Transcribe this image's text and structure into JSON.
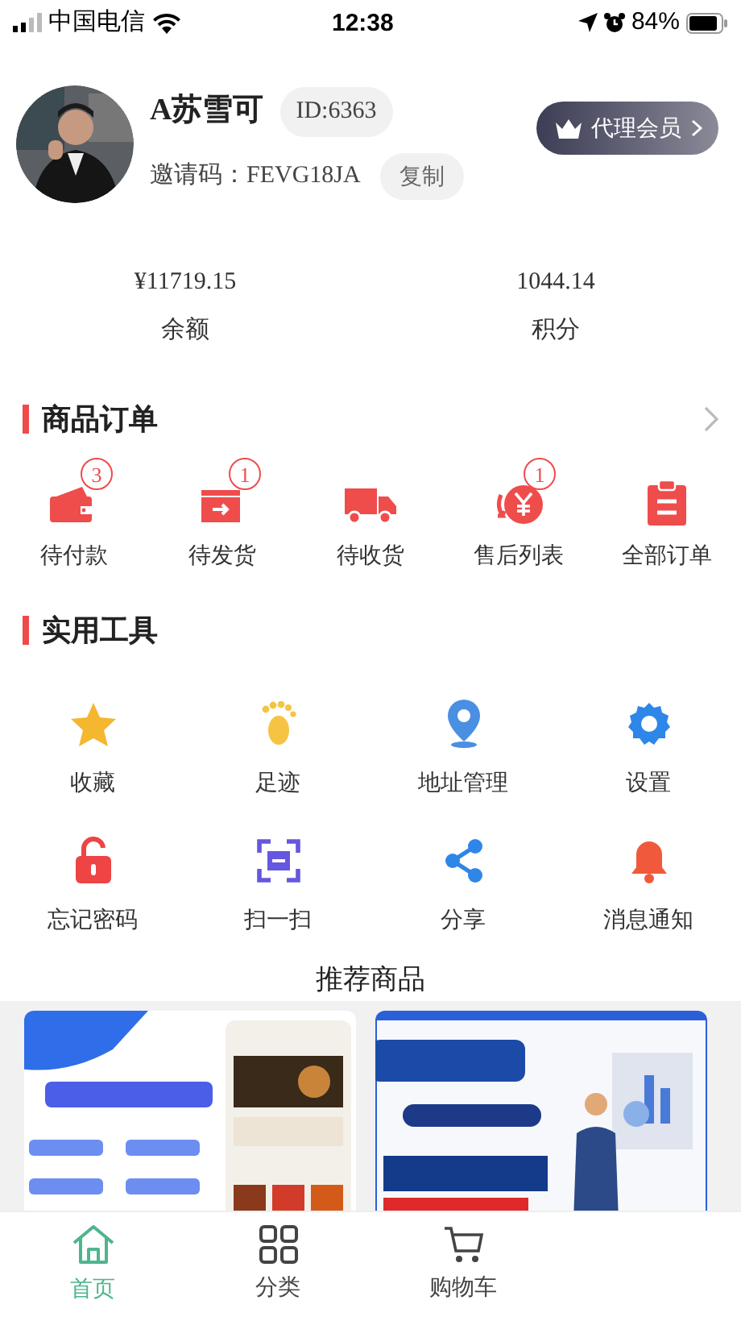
{
  "status_bar": {
    "carrier": "中国电信",
    "time": "12:38",
    "battery": "84%"
  },
  "profile": {
    "name": "A苏雪可",
    "id": "ID:6363",
    "invite_label": "邀请码：",
    "invite_code": "FEVG18JA",
    "copy_button": "复制",
    "member_button": "代理会员"
  },
  "stats": [
    {
      "value": "¥11719.15",
      "label": "余额"
    },
    {
      "value": "1044.14",
      "label": "积分"
    }
  ],
  "orders": {
    "title": "商品订单",
    "items": [
      {
        "label": "待付款",
        "badge": "3"
      },
      {
        "label": "待发货",
        "badge": "1"
      },
      {
        "label": "待收货"
      },
      {
        "label": "售后列表",
        "badge": "1"
      },
      {
        "label": "全部订单"
      }
    ]
  },
  "tools": {
    "title": "实用工具",
    "items": [
      {
        "label": "收藏"
      },
      {
        "label": "足迹"
      },
      {
        "label": "地址管理"
      },
      {
        "label": "设置"
      },
      {
        "label": "忘记密码"
      },
      {
        "label": "扫一扫"
      },
      {
        "label": "分享"
      },
      {
        "label": "消息通知"
      }
    ]
  },
  "recommended": {
    "title": "推荐商品"
  },
  "tab_bar": [
    {
      "label": "首页",
      "selected": true
    },
    {
      "label": "分类",
      "selected": false
    },
    {
      "label": "购物车",
      "selected": false
    }
  ]
}
